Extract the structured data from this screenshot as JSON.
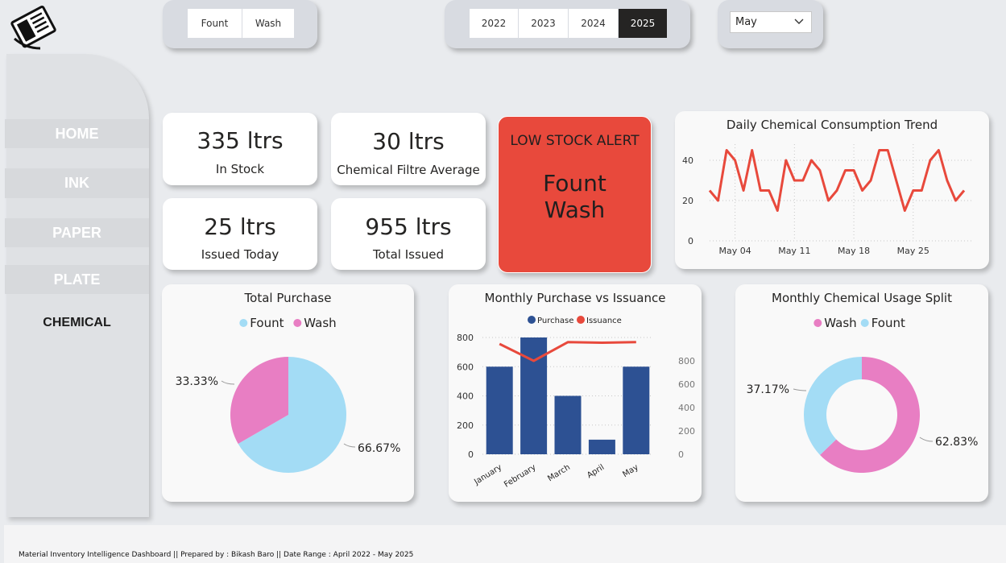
{
  "filters": {
    "material": [
      "Fount",
      "Wash"
    ],
    "years": [
      "2022",
      "2023",
      "2024",
      "2025"
    ],
    "selected_year": "2025",
    "month": "May"
  },
  "nav": [
    {
      "label": "HOME"
    },
    {
      "label": "INK"
    },
    {
      "label": "PAPER"
    },
    {
      "label": "PLATE"
    },
    {
      "label": "CHEMICAL",
      "current": true
    }
  ],
  "kpis": {
    "in_stock": {
      "value": "335 ltrs",
      "label": "In Stock"
    },
    "filtre_avg": {
      "value": "30 ltrs",
      "label": "Chemical Filtre Average"
    },
    "issued_today": {
      "value": "25 ltrs",
      "label": "Issued Today"
    },
    "total_issued": {
      "value": "955 ltrs",
      "label": "Total Issued"
    }
  },
  "alert": {
    "title": "LOW STOCK ALERT",
    "items": [
      "Fount",
      "Wash"
    ]
  },
  "colors": {
    "fount": "#a3dcf5",
    "wash": "#e87ec3",
    "purchase": "#2d5193",
    "issuance": "#e8493c",
    "alert": "#e8493c"
  },
  "chart_data": [
    {
      "type": "line",
      "title": "Daily Chemical Consumption Trend",
      "x_ticks": [
        "May 04",
        "May 11",
        "May 18",
        "May 25"
      ],
      "yticks": [
        0,
        20,
        40
      ],
      "ylim": [
        0,
        48
      ],
      "series": [
        {
          "values": [
            25,
            20,
            45,
            40,
            25,
            45,
            25,
            25,
            15,
            40,
            30,
            30,
            40,
            35,
            20,
            25,
            35,
            35,
            25,
            30,
            45,
            45,
            30,
            15,
            25,
            25,
            40,
            45,
            30,
            20,
            25
          ]
        }
      ],
      "grid": true
    },
    {
      "type": "pie",
      "title": "Total Purchase",
      "legend": [
        "Fount",
        "Wash"
      ],
      "slices": [
        {
          "label": "Fount",
          "value": 66.67,
          "text": "66.67%"
        },
        {
          "label": "Wash",
          "value": 33.33,
          "text": "33.33%"
        }
      ]
    },
    {
      "type": "bar",
      "title": "Monthly Purchase vs Issuance",
      "categories": [
        "January",
        "February",
        "March",
        "April",
        "May"
      ],
      "series": [
        {
          "name": "Purchase",
          "values": [
            600,
            800,
            400,
            100,
            600
          ]
        },
        {
          "name": "Issuance",
          "values": [
            945,
            800,
            960,
            955,
            960
          ]
        }
      ],
      "y_ticks_left": [
        0,
        200,
        400,
        600,
        800
      ],
      "y_ticks_right": [
        0,
        200,
        400,
        600,
        800
      ],
      "ylim_left": [
        0,
        800
      ],
      "ylim_right": [
        0,
        1000
      ]
    },
    {
      "type": "pie",
      "title": "Monthly Chemical Usage Split",
      "legend": [
        "Wash",
        "Fount"
      ],
      "slices": [
        {
          "label": "Wash",
          "value": 62.83,
          "text": "62.83%"
        },
        {
          "label": "Fount",
          "value": 37.17,
          "text": "37.17%"
        }
      ]
    }
  ],
  "footer": "Material Inventory Intelligence Dashboard || Prepared by : Bikash Baro || Date Range : April 2022 - May 2025"
}
